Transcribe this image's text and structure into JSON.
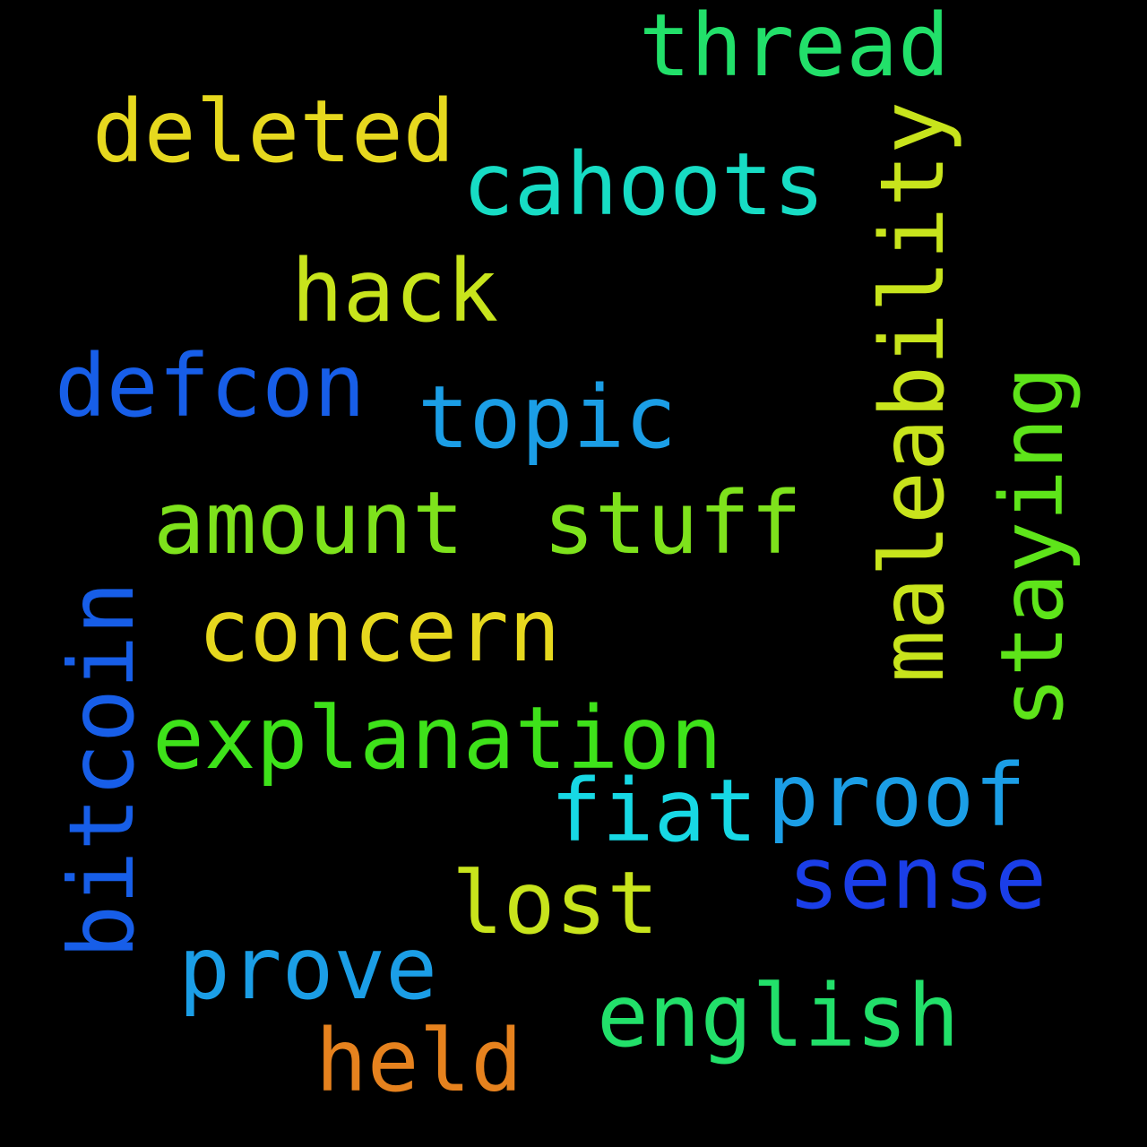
{
  "words": [
    {
      "id": "thread",
      "text": "thread",
      "color": "#22e06a"
    },
    {
      "id": "deleted",
      "text": "deleted",
      "color": "#e6d81e"
    },
    {
      "id": "cahoots",
      "text": "cahoots",
      "color": "#17dcc4"
    },
    {
      "id": "maleability",
      "text": "maleability",
      "color": "#c8e41c"
    },
    {
      "id": "hack",
      "text": "hack",
      "color": "#c8e41c"
    },
    {
      "id": "defcon",
      "text": "defcon",
      "color": "#175ee8"
    },
    {
      "id": "topic",
      "text": "topic",
      "color": "#1b9ee6"
    },
    {
      "id": "staying",
      "text": "staying",
      "color": "#5ee41a"
    },
    {
      "id": "amount",
      "text": "amount",
      "color": "#7ee21c"
    },
    {
      "id": "stuff",
      "text": "stuff",
      "color": "#7ee21c"
    },
    {
      "id": "concern",
      "text": "concern",
      "color": "#e6d81e"
    },
    {
      "id": "bitcoin",
      "text": "bitcoin",
      "color": "#175ee8"
    },
    {
      "id": "explanation",
      "text": "explanation",
      "color": "#3ee21a"
    },
    {
      "id": "fiat",
      "text": "fiat",
      "color": "#17d8e4"
    },
    {
      "id": "proof",
      "text": "proof",
      "color": "#1b9ee6"
    },
    {
      "id": "sense",
      "text": "sense",
      "color": "#1a3ee8"
    },
    {
      "id": "lost",
      "text": "lost",
      "color": "#c8e41c"
    },
    {
      "id": "prove",
      "text": "prove",
      "color": "#1b9ee6"
    },
    {
      "id": "english",
      "text": "english",
      "color": "#22e06a"
    },
    {
      "id": "held",
      "text": "held",
      "color": "#e6821e"
    }
  ]
}
